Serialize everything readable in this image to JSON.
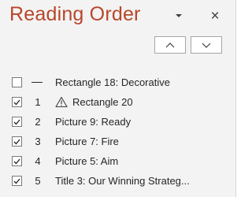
{
  "pane": {
    "title": "Reading Order",
    "dropdown_icon": "chevron-down-icon",
    "close_icon": "close-icon",
    "close_glyph": "×"
  },
  "order_buttons": {
    "up_icon": "chevron-up-icon",
    "down_icon": "chevron-down-icon"
  },
  "items": [
    {
      "checked": false,
      "number": "—",
      "label": "Rectangle 18: Decorative",
      "warning": false
    },
    {
      "checked": true,
      "number": "1",
      "label": "Rectangle 20",
      "warning": true
    },
    {
      "checked": true,
      "number": "2",
      "label": "Picture 9: Ready",
      "warning": false
    },
    {
      "checked": true,
      "number": "3",
      "label": "Picture 7: Fire",
      "warning": false
    },
    {
      "checked": true,
      "number": "4",
      "label": "Picture 5: Aim",
      "warning": false
    },
    {
      "checked": true,
      "number": "5",
      "label": "Title 3: Our Winning Strateg...",
      "warning": false
    }
  ],
  "colors": {
    "title": "#b7472a",
    "pane_background": "#f3f3f3",
    "text": "#262626"
  }
}
